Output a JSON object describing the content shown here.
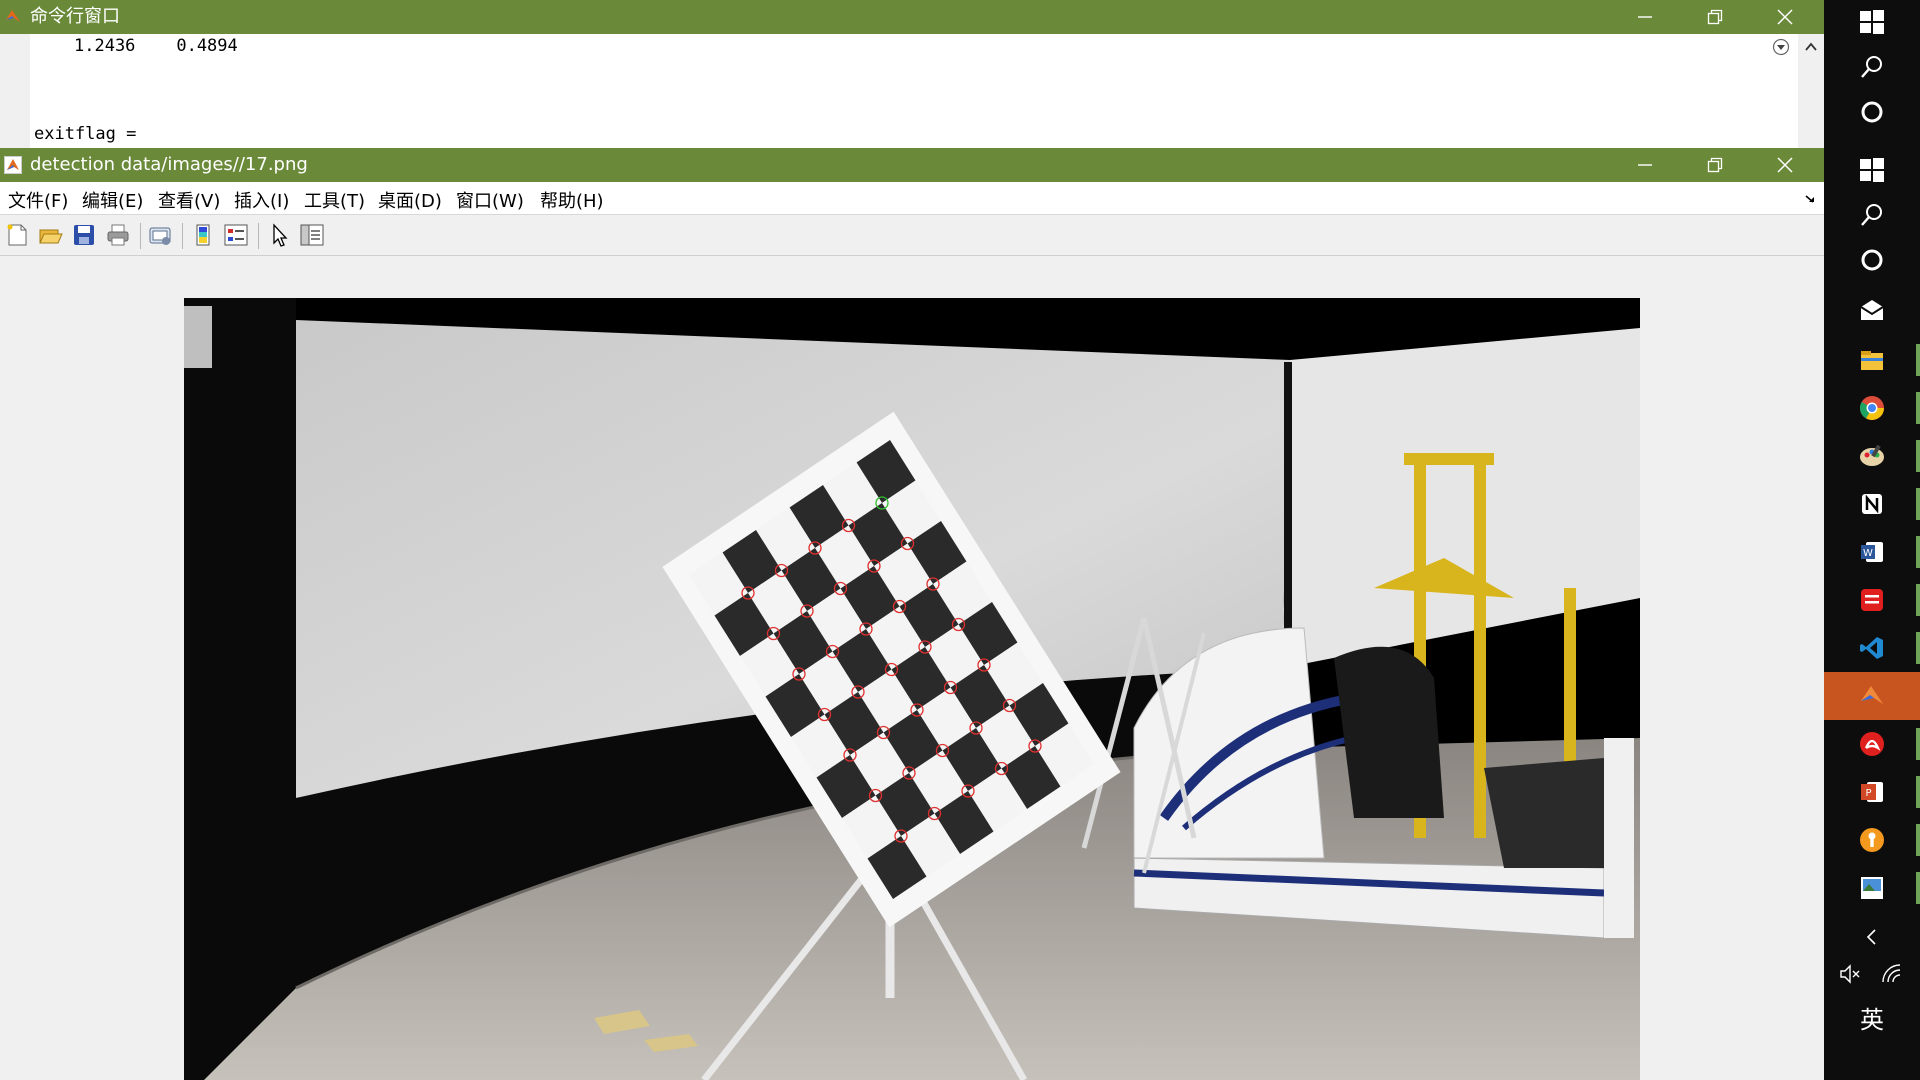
{
  "command_window": {
    "title": "命令行窗口",
    "output_line1": "1.2436    0.4894",
    "output_line2": "exitflag ="
  },
  "figure_window": {
    "title": "detection data/images//17.png",
    "menu": [
      "文件(F)",
      "编辑(E)",
      "查看(V)",
      "插入(I)",
      "工具(T)",
      "桌面(D)",
      "窗口(W)",
      "帮助(H)"
    ]
  },
  "toolbar": {
    "buttons": [
      "new-figure-icon",
      "open-icon",
      "save-icon",
      "print-icon",
      "link-plot-icon",
      "colorbar-icon",
      "legend-icon",
      "edit-plot-arrow-icon",
      "property-inspector-icon"
    ]
  },
  "taskbar": {
    "ime_label": "英"
  },
  "colors": {
    "title_bar": "#6a8a3a",
    "taskbar": "#0d0d0d",
    "active_task": "#c8551f",
    "detected_corner": "#e03030",
    "origin_corner": "#30c030"
  }
}
